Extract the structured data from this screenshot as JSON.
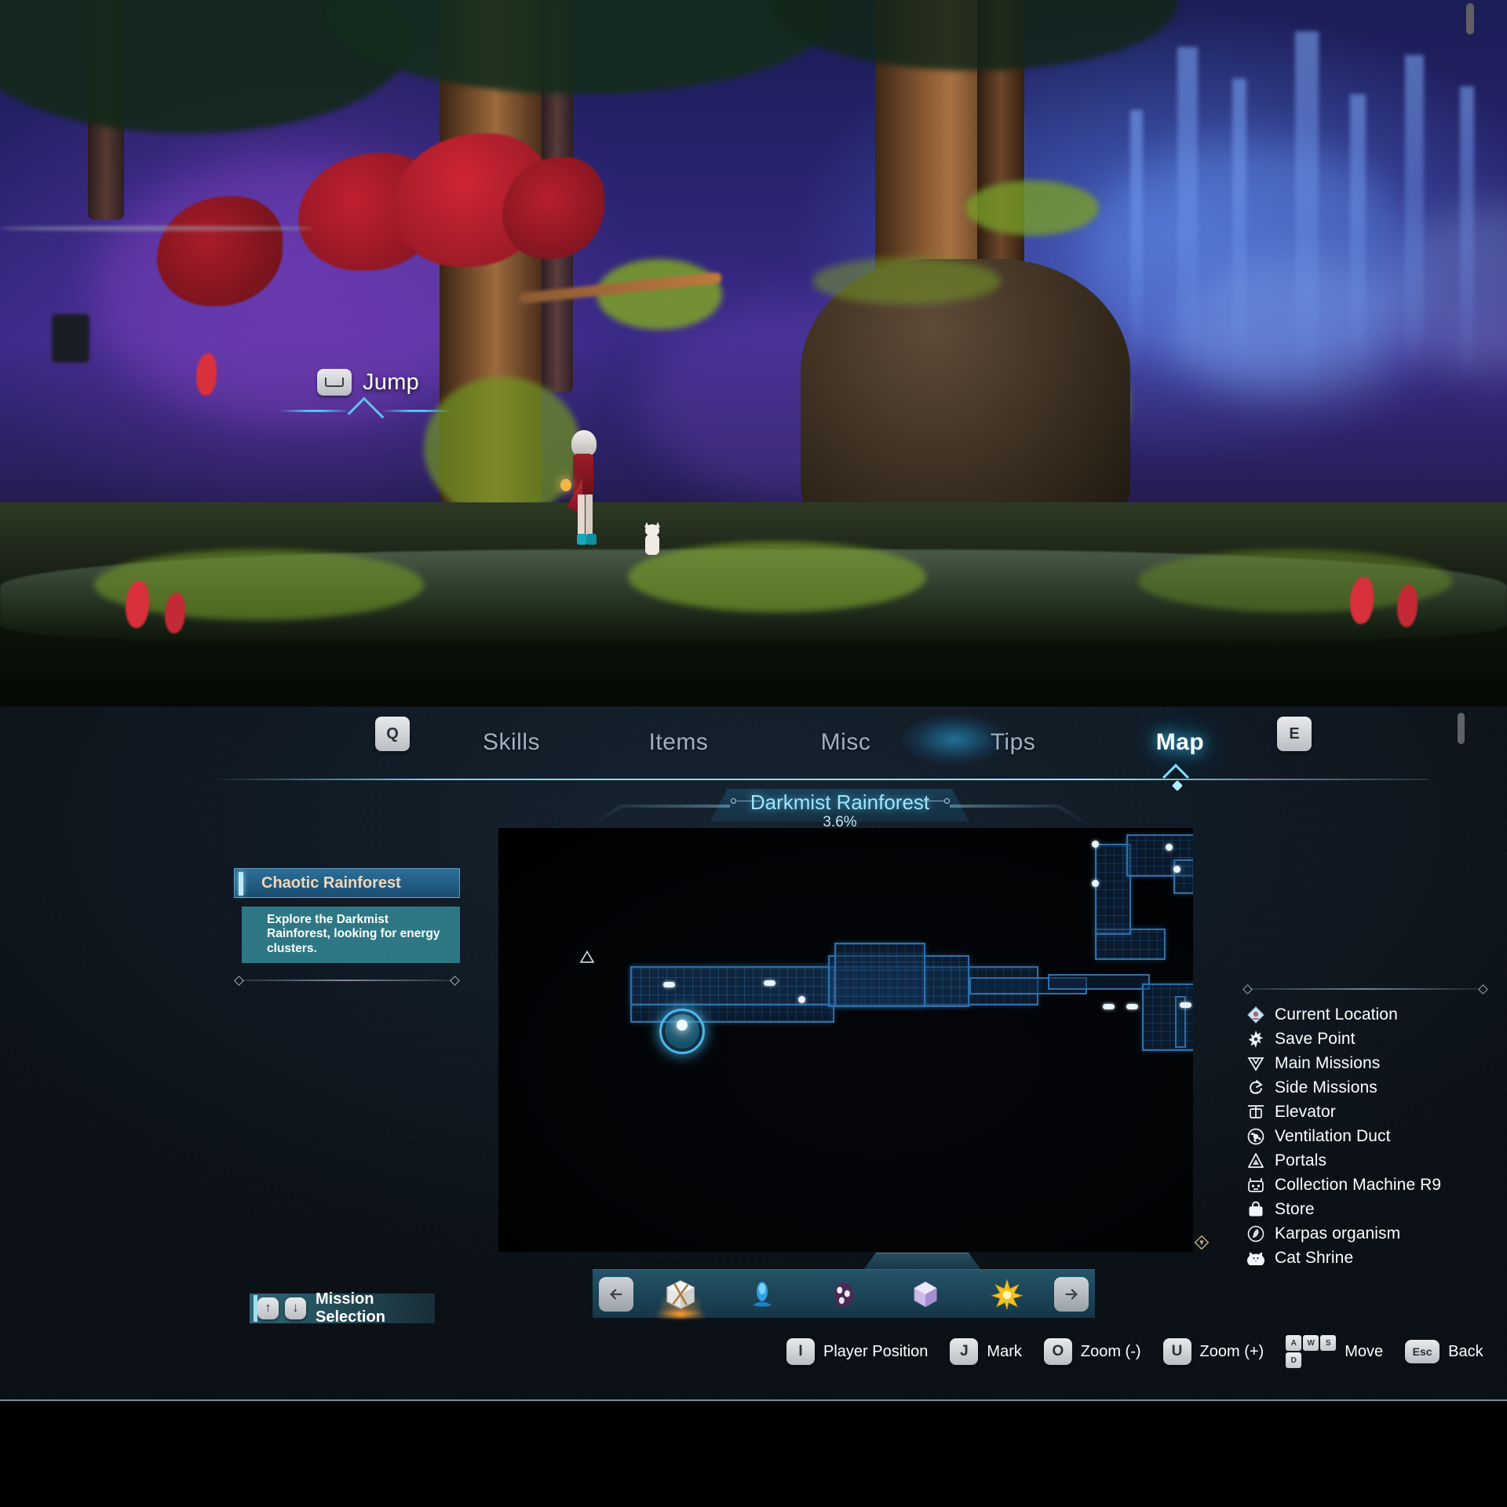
{
  "scene": {
    "prompt": {
      "key": "space-bar",
      "label": "Jump"
    }
  },
  "menu": {
    "left_key": "Q",
    "right_key": "E",
    "tabs": [
      {
        "label": "Skills",
        "active": false
      },
      {
        "label": "Items",
        "active": false
      },
      {
        "label": "Misc",
        "active": false
      },
      {
        "label": "Tips",
        "active": false
      },
      {
        "label": "Map",
        "active": true
      }
    ]
  },
  "zone": {
    "name": "Darkmist Rainforest",
    "completion": "3.6%"
  },
  "mission": {
    "title": "Chaotic Rainforest",
    "description": "Explore the Darkmist Rainforest, looking for energy clusters.",
    "selection_label": "Mission Selection",
    "selection_keys": [
      "↑",
      "↓"
    ]
  },
  "item_bar": {
    "prev_icon": "arrow-left-icon",
    "next_icon": "arrow-right-icon",
    "items": [
      {
        "name": "supply-crate-icon",
        "selected": true
      },
      {
        "name": "blue-fish-icon",
        "selected": false
      },
      {
        "name": "purple-egg-icon",
        "selected": false
      },
      {
        "name": "crystal-cube-icon",
        "selected": false
      },
      {
        "name": "gold-star-icon",
        "selected": false
      }
    ]
  },
  "legend": {
    "items": [
      {
        "icon": "current-location-icon",
        "label": "Current Location"
      },
      {
        "icon": "save-point-icon",
        "label": "Save Point"
      },
      {
        "icon": "main-missions-icon",
        "label": "Main Missions"
      },
      {
        "icon": "side-missions-icon",
        "label": "Side Missions"
      },
      {
        "icon": "elevator-icon",
        "label": "Elevator"
      },
      {
        "icon": "ventilation-duct-icon",
        "label": "Ventilation Duct"
      },
      {
        "icon": "portals-icon",
        "label": "Portals"
      },
      {
        "icon": "collection-machine-icon",
        "label": "Collection Machine R9"
      },
      {
        "icon": "store-icon",
        "label": "Store"
      },
      {
        "icon": "karpas-organism-icon",
        "label": "Karpas organism"
      },
      {
        "icon": "cat-shrine-icon",
        "label": "Cat Shrine"
      }
    ]
  },
  "hints": [
    {
      "key": "I",
      "label": "Player Position"
    },
    {
      "key": "J",
      "label": "Mark"
    },
    {
      "key": "O",
      "label": "Zoom (-)"
    },
    {
      "key": "U",
      "label": "Zoom (+)"
    },
    {
      "key": "WASD",
      "label": "Move"
    },
    {
      "key": "Esc",
      "label": "Back"
    }
  ],
  "colors": {
    "accent_cyan": "#46c8ef",
    "map_room_border": "#2f6fa8",
    "mission_title_text": "#f0d7b8",
    "zone_title": "#9fe6fb"
  }
}
